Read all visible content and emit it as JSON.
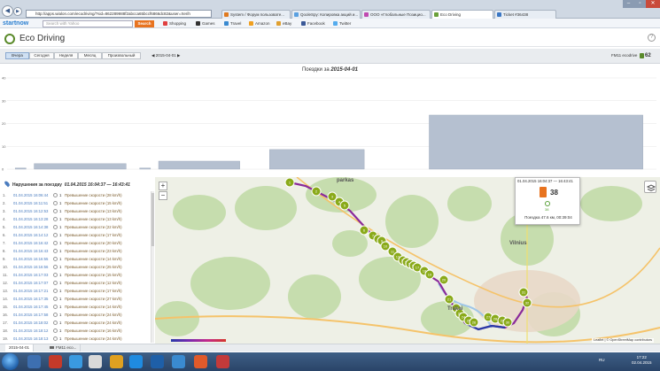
{
  "browser": {
    "address": "http://apps.wialon.com/ecodriving/?sid=862289988f2abcca65bccf6866dc82&user=Xerih",
    "tabs": [
      {
        "label": "System / Форум пользовате...",
        "color": "#e07a1f"
      },
      {
        "label": "QooleSpy: Копировка акций и...",
        "color": "#5aa0e0"
      },
      {
        "label": "ООО «Глобальные Позицио...",
        "color": "#c04ab0"
      },
      {
        "label": "Eco Driving",
        "color": "#6aa03a"
      },
      {
        "label": "Ticket #36438",
        "color": "#3b77c4"
      }
    ]
  },
  "bookmarks": {
    "brand": "startnow",
    "search_placeholder": "Search with Yahoo",
    "search_button": "Search",
    "items": [
      {
        "label": "Shopping",
        "color": "#e04040"
      },
      {
        "label": "Games",
        "color": "#333"
      },
      {
        "label": "Travel",
        "color": "#3a8ad0"
      },
      {
        "label": "Amazon",
        "color": "#f0a020"
      },
      {
        "label": "eBay",
        "color": "#e0a030"
      },
      {
        "label": "Facebook",
        "color": "#3b5998"
      },
      {
        "label": "Twitter",
        "color": "#55acee"
      }
    ]
  },
  "app": {
    "title": "Eco Driving",
    "help": "?"
  },
  "toolbar": {
    "periods": [
      "Вчера",
      "Сегодня",
      "Неделя",
      "Месяц",
      "Произвольный"
    ],
    "selected_period": "Вчера",
    "prev_arrow": "◀",
    "date": "2015-04-01",
    "next_arrow": "▶",
    "unit": "FM11 ecodrive",
    "score": "62"
  },
  "chart_title": {
    "prefix": "Поездки за ",
    "date": "2015-04-01"
  },
  "chart_data": {
    "type": "bar",
    "title": "Поездки за 2015-04-01",
    "ylim": [
      0,
      40
    ],
    "yticks": [
      0,
      10,
      20,
      30,
      40
    ],
    "grid": true,
    "bars": [
      {
        "x": 0.3,
        "width": 0.4,
        "value": 0.5
      },
      {
        "x": 1.0,
        "width": 3.4,
        "value": 2.4
      },
      {
        "x": 4.9,
        "width": 0.4,
        "value": 0.5
      },
      {
        "x": 5.6,
        "width": 3.0,
        "value": 3.5
      },
      {
        "x": 9.7,
        "width": 3.5,
        "value": 8.6
      },
      {
        "x": 15.6,
        "width": 7.9,
        "value": 23.7
      }
    ],
    "xlim": [
      0,
      24
    ],
    "color": "#b5c0d0"
  },
  "violations": {
    "title": "Нарушения за поездку",
    "period": "01.04.2015 16:04:37 — 16:43:41",
    "rows": [
      {
        "n": "1.",
        "date": "01.04.2015 16:06:44",
        "count": "1",
        "type": "Превышение скорости (28 km/h)"
      },
      {
        "n": "2.",
        "date": "01.04.2015 16:11:51",
        "count": "1",
        "type": "Превышение скорости (15 km/h)"
      },
      {
        "n": "3.",
        "date": "01.04.2015 16:12:53",
        "count": "1",
        "type": "Превышение скорости (13 km/h)"
      },
      {
        "n": "4.",
        "date": "01.04.2015 16:13:28",
        "count": "1",
        "type": "Превышение скорости (13 km/h)"
      },
      {
        "n": "5.",
        "date": "01.04.2015 16:14:38",
        "count": "1",
        "type": "Превышение скорости (22 km/h)"
      },
      {
        "n": "6.",
        "date": "01.04.2015 16:14:12",
        "count": "1",
        "type": "Превышение скорости (17 km/h)"
      },
      {
        "n": "7.",
        "date": "01.04.2015 16:16:42",
        "count": "1",
        "type": "Превышение скорости (20 km/h)"
      },
      {
        "n": "8.",
        "date": "01.04.2015 16:16:43",
        "count": "1",
        "type": "Превышение скорости (23 km/h)"
      },
      {
        "n": "9.",
        "date": "01.04.2015 16:16:55",
        "count": "1",
        "type": "Превышение скорости (14 km/h)"
      },
      {
        "n": "10.",
        "date": "01.04.2015 16:16:56",
        "count": "1",
        "type": "Превышение скорости (25 km/h)"
      },
      {
        "n": "11.",
        "date": "01.04.2015 16:17:03",
        "count": "1",
        "type": "Превышение скорости (15 km/h)"
      },
      {
        "n": "12.",
        "date": "01.04.2015 16:17:07",
        "count": "1",
        "type": "Превышение скорости (12 km/h)"
      },
      {
        "n": "13.",
        "date": "01.04.2015 16:17:21",
        "count": "1",
        "type": "Превышение скорости (17 km/h)"
      },
      {
        "n": "14.",
        "date": "01.04.2015 16:17:35",
        "count": "1",
        "type": "Превышение скорости (27 km/h)"
      },
      {
        "n": "15.",
        "date": "01.04.2015 16:17:45",
        "count": "1",
        "type": "Превышение скорости (14 km/h)"
      },
      {
        "n": "16.",
        "date": "01.04.2015 16:17:58",
        "count": "1",
        "type": "Превышение скорости (24 km/h)"
      },
      {
        "n": "17.",
        "date": "01.04.2015 16:18:02",
        "count": "1",
        "type": "Превышение скорости (24 km/h)"
      },
      {
        "n": "18.",
        "date": "01.04.2015 16:18:12",
        "count": "1",
        "type": "Превышение скорости (16 km/h)"
      },
      {
        "n": "19.",
        "date": "01.04.2015 16:18:13",
        "count": "1",
        "type": "Превышение скорости (24 km/h)"
      }
    ]
  },
  "map": {
    "zoom_in": "+",
    "zoom_out": "−",
    "attribution": "Leaflet | © OpenStreetMap contributors",
    "labels": [
      "Vilnius",
      "Trakai",
      "parkas"
    ],
    "markers": [
      "1",
      "2",
      "3",
      "4",
      "5",
      "6",
      "7",
      "8",
      "9",
      "10",
      "11",
      "12",
      "13",
      "14",
      "15",
      "16",
      "17",
      "18",
      "19",
      "20",
      "21",
      "22",
      "23",
      "24",
      "25",
      "26",
      "27",
      "28",
      "29",
      "30",
      "31",
      "32",
      "33",
      "34",
      "35",
      "36",
      "37",
      "38"
    ]
  },
  "info": {
    "period": "01.04.2015 16:04:37 — 16:43:41",
    "violations": "38",
    "check": "38",
    "summary": "Поездка 47.6 км, 00:39:04"
  },
  "bottom_tabs": [
    "2015-04-01",
    "FM11 eco..."
  ],
  "clock": {
    "time": "17:22",
    "date": "02.04.2015",
    "lang": "RU"
  }
}
